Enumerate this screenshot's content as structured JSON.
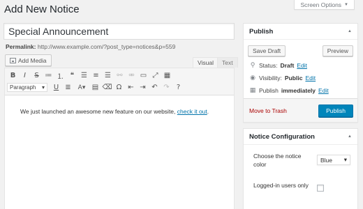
{
  "header": {
    "title": "Add New Notice",
    "screen_options": "Screen Options"
  },
  "post": {
    "title": "Special Announcement",
    "permalink_label": "Permalink:",
    "permalink_url": "http://www.example.com/?post_type=notices&p=559"
  },
  "editor": {
    "add_media": "Add Media",
    "tabs": {
      "visual": "Visual",
      "text": "Text"
    },
    "format_select": "Paragraph",
    "content_text": "We just launched an awesome new feature on our website,",
    "content_link": "check it out",
    "content_end": ".",
    "toolbar_row1": [
      {
        "name": "bold-icon",
        "glyph": "B"
      },
      {
        "name": "italic-icon",
        "glyph": "I"
      },
      {
        "name": "strikethrough-icon",
        "glyph": "S"
      },
      {
        "name": "bullet-list-icon",
        "glyph": "≔"
      },
      {
        "name": "numbered-list-icon",
        "glyph": "⒈"
      },
      {
        "name": "blockquote-icon",
        "glyph": "❝"
      },
      {
        "name": "align-left-icon",
        "glyph": "☰"
      },
      {
        "name": "align-center-icon",
        "glyph": "≡"
      },
      {
        "name": "align-right-icon",
        "glyph": "☰"
      },
      {
        "name": "insert-link-icon",
        "glyph": "⚯"
      },
      {
        "name": "remove-link-icon",
        "glyph": "⚮"
      },
      {
        "name": "read-more-icon",
        "glyph": "▭"
      },
      {
        "name": "fullscreen-icon",
        "glyph": "⤢"
      },
      {
        "name": "toolbar-toggle-icon",
        "glyph": "▦"
      }
    ],
    "toolbar_row2": [
      {
        "name": "underline-icon",
        "glyph": "U"
      },
      {
        "name": "justify-icon",
        "glyph": "≣"
      },
      {
        "name": "text-color-icon",
        "glyph": "A▾"
      },
      {
        "name": "paste-text-icon",
        "glyph": "▤"
      },
      {
        "name": "clear-formatting-icon",
        "glyph": "⌫"
      },
      {
        "name": "special-character-icon",
        "glyph": "Ω"
      },
      {
        "name": "outdent-icon",
        "glyph": "⇤"
      },
      {
        "name": "indent-icon",
        "glyph": "⇥"
      },
      {
        "name": "undo-icon",
        "glyph": "↶"
      },
      {
        "name": "redo-icon",
        "glyph": "↷"
      },
      {
        "name": "help-icon",
        "glyph": "?"
      }
    ]
  },
  "publish": {
    "title": "Publish",
    "save_draft": "Save Draft",
    "preview": "Preview",
    "status_label": "Status:",
    "status_value": "Draft",
    "visibility_label": "Visibility:",
    "visibility_value": "Public",
    "publish_label": "Publish",
    "publish_value": "immediately",
    "edit": "Edit",
    "move_to_trash": "Move to Trash",
    "publish_button": "Publish"
  },
  "config": {
    "title": "Notice Configuration",
    "color_label": "Choose the notice color",
    "color_value": "Blue",
    "logged_in_label": "Logged-in users only"
  },
  "colors": {
    "primary": "#0085ba",
    "link": "#0073aa",
    "trash": "#a00000"
  }
}
